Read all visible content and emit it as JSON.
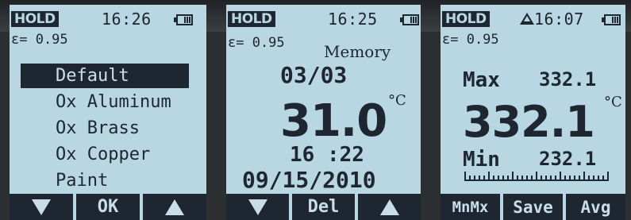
{
  "screens": [
    {
      "status": {
        "hold": "HOLD",
        "time": "16:26",
        "emissivity": "ε= 0.95"
      },
      "menu": [
        "Default",
        "Ox Aluminum",
        "Ox Brass",
        "Ox Copper",
        "Paint"
      ],
      "selected_index": 0,
      "softkeys": [
        "",
        "OK",
        ""
      ]
    },
    {
      "status": {
        "hold": "HOLD",
        "time": "16:25",
        "emissivity": "ε= 0.95"
      },
      "mode": "Memory",
      "record": "03/03",
      "temperature": "31.0",
      "unit": "°C",
      "time": "16 :22",
      "date": "09/15/2010",
      "softkeys": [
        "",
        "Del",
        ""
      ]
    },
    {
      "status": {
        "hold": "HOLD",
        "time": "16:07",
        "emissivity": "ε= 0.95"
      },
      "max_label": "Max",
      "max_value": "332.1",
      "temperature": "332.1",
      "unit": "°C",
      "min_label": "Min",
      "min_value": "232.1",
      "softkeys": [
        "MnMx",
        "Save",
        "Avg"
      ]
    }
  ],
  "colors": {
    "lcd": "#b9d6e3",
    "ink": "#1e2731"
  },
  "icons": [
    "battery-icon",
    "warning-icon",
    "down-arrow-icon",
    "up-arrow-icon"
  ]
}
